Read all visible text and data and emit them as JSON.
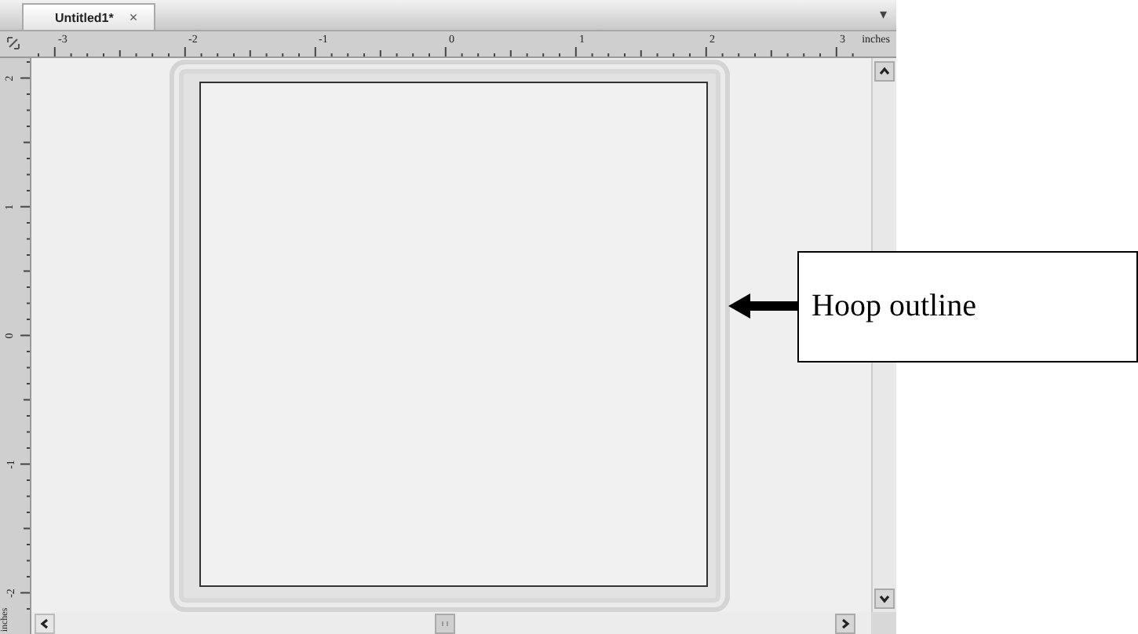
{
  "tabs": [
    {
      "label": "Untitled1*",
      "selected": true,
      "close": "×"
    }
  ],
  "tab_menu": "▾",
  "ruler_horizontal": {
    "labels": [
      "-3",
      "-2",
      "-1",
      "0",
      "1",
      "2",
      "3"
    ],
    "unit": "inches"
  },
  "ruler_vertical": {
    "labels": [
      "2",
      "1",
      "0",
      "-1",
      "-2"
    ],
    "unit": "inches"
  },
  "callout": {
    "text": "Hoop outline"
  }
}
